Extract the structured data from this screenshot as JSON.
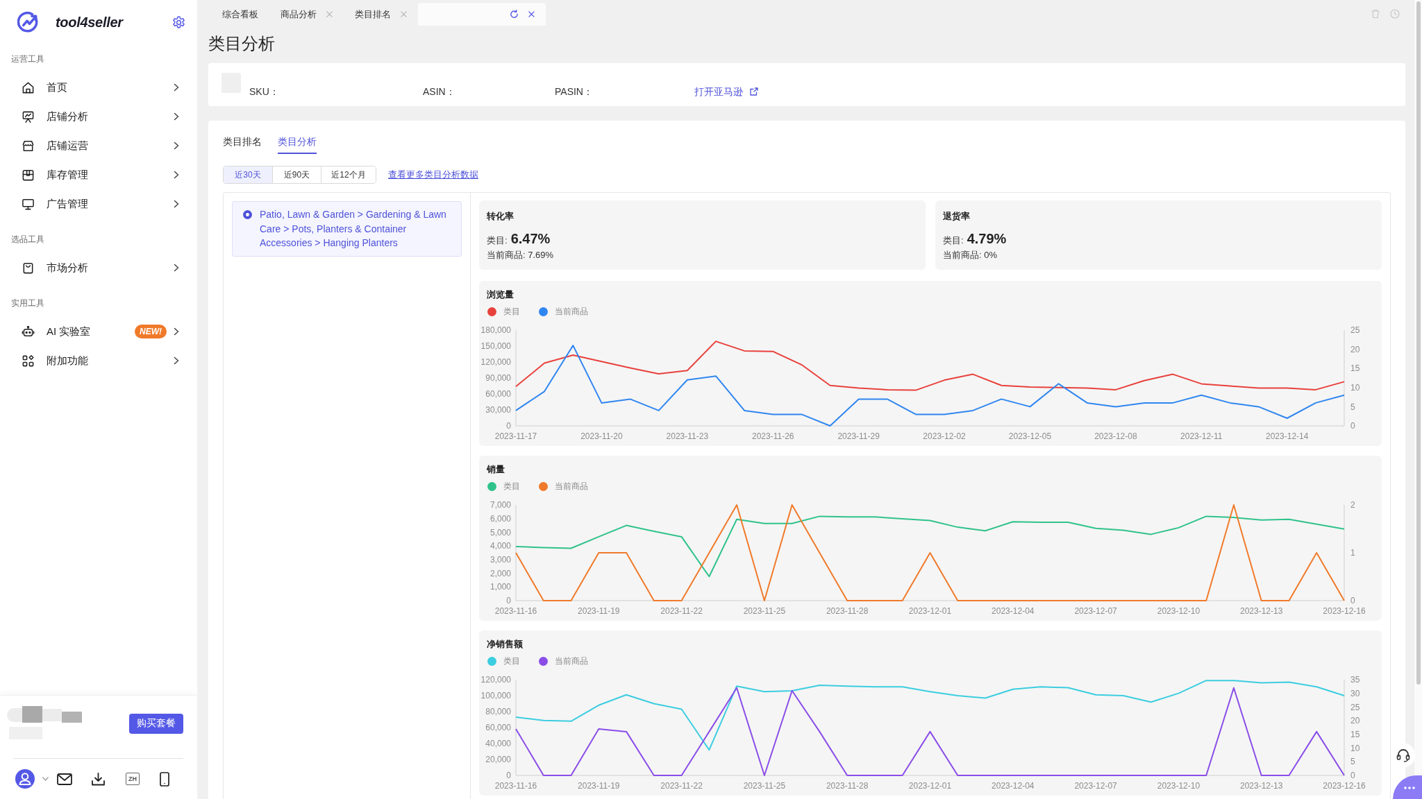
{
  "sidebar": {
    "brand": "tool4seller",
    "sections": [
      {
        "heading": "运营工具",
        "items": [
          {
            "label": "首页"
          },
          {
            "label": "店铺分析"
          },
          {
            "label": "店铺运营"
          },
          {
            "label": "库存管理"
          },
          {
            "label": "广告管理"
          }
        ]
      },
      {
        "heading": "选品工具",
        "items": [
          {
            "label": "市场分析"
          }
        ]
      },
      {
        "heading": "实用工具",
        "items": [
          {
            "label": "AI 实验室",
            "badge": "NEW!"
          },
          {
            "label": "附加功能"
          }
        ]
      }
    ],
    "buy_button": "购买套餐",
    "language_button": "ZH"
  },
  "tabs": [
    {
      "label": "综合看板",
      "selected": false,
      "closable": false
    },
    {
      "label": "商品分析",
      "selected": false,
      "closable": true
    },
    {
      "label": "类目排名",
      "selected": false,
      "closable": true
    },
    {
      "selected": true,
      "closable": true
    }
  ],
  "page_title": "类目分析",
  "product_info": {
    "fields": [
      {
        "label": "SKU："
      },
      {
        "label": "ASIN："
      },
      {
        "label": "PASIN："
      }
    ],
    "link": "打开亚马逊"
  },
  "sub_tabs": [
    {
      "label": "类目排名",
      "selected": false
    },
    {
      "label": "类目分析",
      "selected": true
    }
  ],
  "periods": [
    {
      "label": "近30天",
      "selected": true
    },
    {
      "label": "近90天",
      "selected": false
    },
    {
      "label": "近12个月",
      "selected": false
    }
  ],
  "more_link": "查看更多类目分析数据",
  "categories": [
    {
      "label": "Patio, Lawn & Garden > Gardening & Lawn Care > Pots, Planters & Container Accessories > Hanging Planters",
      "selected": true
    }
  ],
  "stats": [
    {
      "title": "转化率",
      "category": {
        "label": "类目:",
        "value": "6.47%"
      },
      "current": "当前商品: 7.69%"
    },
    {
      "title": "退货率",
      "category": {
        "label": "类目:",
        "value": "4.79%"
      },
      "current": "当前商品: 0%"
    }
  ],
  "charts": [
    {
      "chart_data": {
        "type": "line",
        "title": "浏览量",
        "categories": [
          "2023-11-17",
          null,
          null,
          "2023-11-20",
          null,
          null,
          "2023-11-23",
          null,
          null,
          "2023-11-26",
          null,
          null,
          "2023-11-29",
          null,
          null,
          "2023-12-02",
          null,
          null,
          "2023-12-05",
          null,
          null,
          "2023-12-08",
          null,
          null,
          "2023-12-11",
          null,
          null,
          "2023-12-14",
          null,
          null
        ],
        "ylim": [
          0,
          180000
        ],
        "yticks": [
          {
            "value": 0,
            "label": "0"
          },
          {
            "value": 30000,
            "label": "30,000"
          },
          {
            "value": 60000,
            "label": "60,000"
          },
          {
            "value": 90000,
            "label": "90,000"
          },
          {
            "value": 120000,
            "label": "120,000"
          },
          {
            "value": 150000,
            "label": "150,000"
          },
          {
            "value": 180000,
            "label": "180,000"
          }
        ],
        "y2lim": [
          0,
          25
        ],
        "y2ticks": [
          {
            "value": 0,
            "label": "0"
          },
          {
            "value": 5,
            "label": "5"
          },
          {
            "value": 10,
            "label": "10"
          },
          {
            "value": 15,
            "label": "15"
          },
          {
            "value": 20,
            "label": "20"
          },
          {
            "value": 25,
            "label": "25"
          }
        ],
        "series": [
          {
            "name": "类目",
            "color": "#e8413c",
            "values": [
              74000,
              118000,
              133000,
              121000,
              109000,
              98000,
              104000,
              159000,
              141000,
              140000,
              115000,
              76000,
              71000,
              68000,
              67000,
              86000,
              97000,
              76000,
              73000,
              72000,
              71000,
              68000,
              85000,
              97000,
              79000,
              75000,
              71000,
              71000,
              68000,
              83000
            ]
          },
          {
            "name": "当前商品",
            "color": "#2f86f0",
            "axis": "y2",
            "values": [
              4,
              9,
              21,
              6,
              7,
              4,
              12,
              13,
              4,
              3,
              3,
              0,
              7,
              7,
              3,
              3,
              4,
              7,
              5,
              11,
              6,
              5,
              6,
              6,
              8,
              6,
              5,
              2,
              6,
              8
            ]
          }
        ]
      }
    },
    {
      "chart_data": {
        "type": "line",
        "title": "销量",
        "categories": [
          "2023-11-16",
          null,
          null,
          "2023-11-19",
          null,
          null,
          "2023-11-22",
          null,
          null,
          "2023-11-25",
          null,
          null,
          "2023-11-28",
          null,
          null,
          "2023-12-01",
          null,
          null,
          "2023-12-04",
          null,
          null,
          "2023-12-07",
          null,
          null,
          "2023-12-10",
          null,
          null,
          "2023-12-13",
          null,
          null,
          "2023-12-16"
        ],
        "ylim": [
          0,
          7000
        ],
        "yticks": [
          {
            "value": 0,
            "label": "0"
          },
          {
            "value": 1000,
            "label": "1,000"
          },
          {
            "value": 2000,
            "label": "2,000"
          },
          {
            "value": 3000,
            "label": "3,000"
          },
          {
            "value": 4000,
            "label": "4,000"
          },
          {
            "value": 5000,
            "label": "5,000"
          },
          {
            "value": 6000,
            "label": "6,000"
          },
          {
            "value": 7000,
            "label": "7,000"
          }
        ],
        "y2lim": [
          0,
          2
        ],
        "y2ticks": [
          {
            "value": 0,
            "label": "0"
          },
          {
            "value": 1,
            "label": "1"
          },
          {
            "value": 2,
            "label": "2"
          }
        ],
        "series": [
          {
            "name": "类目",
            "color": "#2fc28b",
            "values": [
              3960,
              3880,
              3830,
              4670,
              5500,
              5070,
              4670,
              1760,
              5950,
              5640,
              5640,
              6170,
              6120,
              6120,
              5990,
              5860,
              5370,
              5110,
              5770,
              5730,
              5730,
              5290,
              5150,
              4850,
              5330,
              6170,
              6080,
              5900,
              5950,
              5590,
              5240
            ]
          },
          {
            "name": "当前商品",
            "color": "#f07a2a",
            "axis": "y2",
            "values": [
              1,
              0,
              0,
              1,
              1,
              0,
              0,
              1,
              2,
              0,
              2,
              1,
              0,
              0,
              0,
              1,
              0,
              0,
              0,
              0,
              0,
              0,
              0,
              0,
              0,
              0,
              2,
              0,
              0,
              1,
              0
            ]
          }
        ]
      }
    },
    {
      "chart_data": {
        "type": "line",
        "title": "净销售额",
        "categories": [
          "2023-11-16",
          null,
          null,
          "2023-11-19",
          null,
          null,
          "2023-11-22",
          null,
          null,
          "2023-11-25",
          null,
          null,
          "2023-11-28",
          null,
          null,
          "2023-12-01",
          null,
          null,
          "2023-12-04",
          null,
          null,
          "2023-12-07",
          null,
          null,
          "2023-12-10",
          null,
          null,
          "2023-12-13",
          null,
          null,
          "2023-12-16"
        ],
        "ylim": [
          0,
          120000
        ],
        "yticks": [
          {
            "value": 0,
            "label": "0"
          },
          {
            "value": 20000,
            "label": "20,000"
          },
          {
            "value": 40000,
            "label": "40,000"
          },
          {
            "value": 60000,
            "label": "60,000"
          },
          {
            "value": 80000,
            "label": "80,000"
          },
          {
            "value": 100000,
            "label": "100,000"
          },
          {
            "value": 120000,
            "label": "120,000"
          }
        ],
        "y2lim": [
          0,
          35
        ],
        "y2ticks": [
          {
            "value": 0,
            "label": "0"
          },
          {
            "value": 5,
            "label": "5"
          },
          {
            "value": 10,
            "label": "10"
          },
          {
            "value": 15,
            "label": "15"
          },
          {
            "value": 20,
            "label": "20"
          },
          {
            "value": 25,
            "label": "25"
          },
          {
            "value": 30,
            "label": "30"
          },
          {
            "value": 35,
            "label": "35"
          }
        ],
        "series": [
          {
            "name": "类目",
            "color": "#3bcde0",
            "values": [
              73000,
              69000,
              68000,
              88000,
              101000,
              90000,
              83000,
              32000,
              112000,
              105000,
              106000,
              113000,
              112000,
              111000,
              111000,
              105000,
              100000,
              97000,
              108000,
              111000,
              110000,
              101000,
              100000,
              92000,
              103000,
              119000,
              119000,
              116000,
              117000,
              111000,
              100000
            ]
          },
          {
            "name": "当前商品",
            "color": "#8a4de8",
            "axis": "y2",
            "values": [
              17,
              0,
              0,
              17,
              16,
              0,
              0,
              16,
              32,
              0,
              31,
              16,
              0,
              0,
              0,
              16,
              0,
              0,
              0,
              0,
              0,
              0,
              0,
              0,
              0,
              0,
              32,
              0,
              0,
              16,
              0
            ]
          }
        ]
      }
    }
  ]
}
